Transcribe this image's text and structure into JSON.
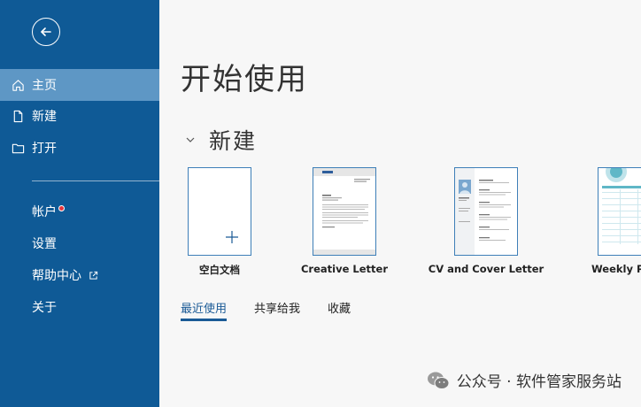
{
  "sidebar": {
    "nav": [
      {
        "label": "主页",
        "icon": "home-icon",
        "active": true
      },
      {
        "label": "新建",
        "icon": "new-document-icon",
        "active": false
      },
      {
        "label": "打开",
        "icon": "folder-icon",
        "active": false
      }
    ],
    "sub": [
      {
        "label": "帐户"
      },
      {
        "label": "设置"
      },
      {
        "label": "帮助中心"
      },
      {
        "label": "关于"
      }
    ],
    "colors": {
      "background": "#0f5a96",
      "active": "#5e97c5",
      "badge": "#e8343b"
    }
  },
  "main": {
    "title": "开始使用",
    "section_title": "新建",
    "templates": [
      {
        "label": "空白文档"
      },
      {
        "label": "Creative Letter"
      },
      {
        "label": "CV and Cover Letter"
      },
      {
        "label": "Weekly Pla"
      }
    ],
    "tabs": [
      {
        "label": "最近使用",
        "active": true
      },
      {
        "label": "共享给我",
        "active": false
      },
      {
        "label": "收藏",
        "active": false
      }
    ]
  },
  "watermark": {
    "text": "公众号 · 软件管家服务站",
    "icon": "wechat-icon"
  }
}
